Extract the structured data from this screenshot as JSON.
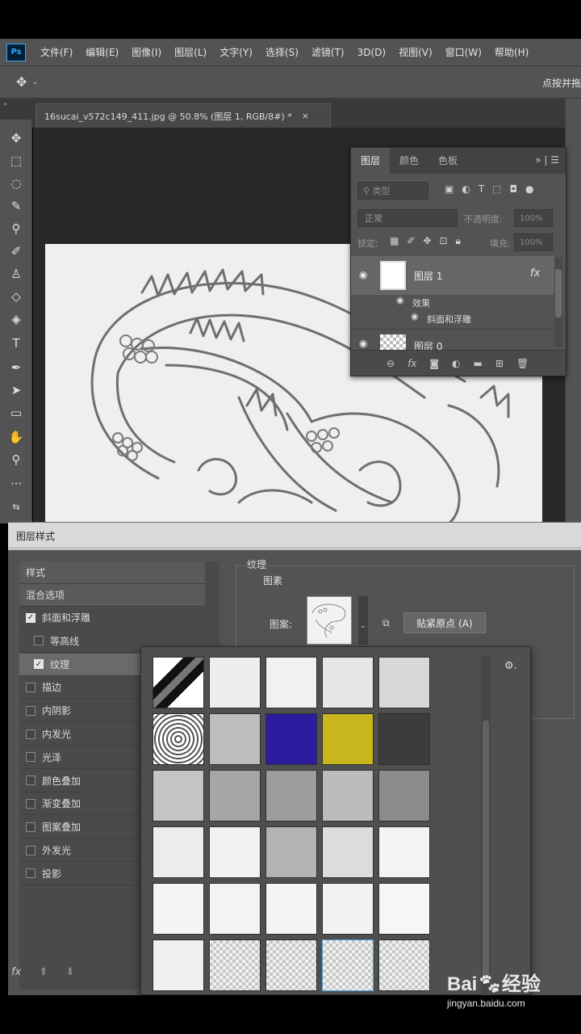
{
  "menubar": {
    "logo": "Ps",
    "items": [
      "文件(F)",
      "编辑(E)",
      "图像(I)",
      "图层(L)",
      "文字(Y)",
      "选择(S)",
      "滤镜(T)",
      "3D(D)",
      "视图(V)",
      "窗口(W)",
      "帮助(H)"
    ]
  },
  "optionsbar": {
    "right_text": "点按并拖"
  },
  "document_tab": {
    "title": "16sucai_v572c149_411.jpg @ 50.8% (图层 1, RGB/8#) *",
    "close": "×"
  },
  "layers_panel": {
    "tabs": [
      "图层",
      "颜色",
      "色板"
    ],
    "active_tab": "图层",
    "search_placeholder": "类型",
    "blend_mode": "正常",
    "opacity_label": "不透明度:",
    "opacity_value": "100%",
    "lock_label": "锁定:",
    "fill_label": "填充:",
    "fill_value": "100%",
    "layers": [
      {
        "name": "图层 1",
        "fx": "fx",
        "effects_label": "效果",
        "effect": "斜面和浮雕"
      },
      {
        "name": "图层 0"
      }
    ]
  },
  "layer_style_dialog": {
    "title": "图层样式",
    "style_list": {
      "header_style": "样式",
      "header_blend": "混合选项",
      "items": [
        {
          "label": "斜面和浮雕",
          "checked": true,
          "indent": false
        },
        {
          "label": "等高线",
          "checked": false,
          "indent": true
        },
        {
          "label": "纹理",
          "checked": true,
          "indent": true,
          "selected": true
        },
        {
          "label": "描边",
          "checked": false,
          "indent": false
        },
        {
          "label": "内阴影",
          "checked": false,
          "indent": false
        },
        {
          "label": "内发光",
          "checked": false,
          "indent": false
        },
        {
          "label": "光泽",
          "checked": false,
          "indent": false
        },
        {
          "label": "颜色叠加",
          "checked": false,
          "indent": false
        },
        {
          "label": "渐变叠加",
          "checked": false,
          "indent": false
        },
        {
          "label": "图案叠加",
          "checked": false,
          "indent": false
        },
        {
          "label": "外发光",
          "checked": false,
          "indent": false
        },
        {
          "label": "投影",
          "checked": false,
          "indent": false
        }
      ],
      "footer_fx": "fx"
    },
    "texture_group": "纹理",
    "pattern_group": "图素",
    "pattern_label": "图案:",
    "snap_button": "贴紧原点 (A)"
  },
  "pattern_picker": {
    "swatch_colors": [
      [
        "#f4f4f4",
        "#eeeeee",
        "#f1f1f1",
        "#e6e6e6",
        "#d8d8d8"
      ],
      [
        "#ffffff",
        "#bdbdbd",
        "#2b1d9e",
        "#c9b51c",
        "#3c3c3c"
      ],
      [
        "#c4c4c4",
        "#a6a6a6",
        "#9c9c9c",
        "#bcbcbc",
        "#8c8c8c"
      ],
      [
        "#ececec",
        "#f2f2f2",
        "#b3b3b3",
        "#dcdcdc",
        "#f3f3f3"
      ],
      [
        "#f5f5f5",
        "#f3f3f3",
        "#f4f4f4",
        "#f2f2f2",
        "#f6f6f6"
      ],
      [
        "#efefef",
        "#dedede",
        "#dedede",
        "#dedede",
        "#dedede"
      ]
    ]
  },
  "watermark": {
    "brand": "Bai",
    "brand2": "经验",
    "url": "jingyan.baidu.com"
  }
}
